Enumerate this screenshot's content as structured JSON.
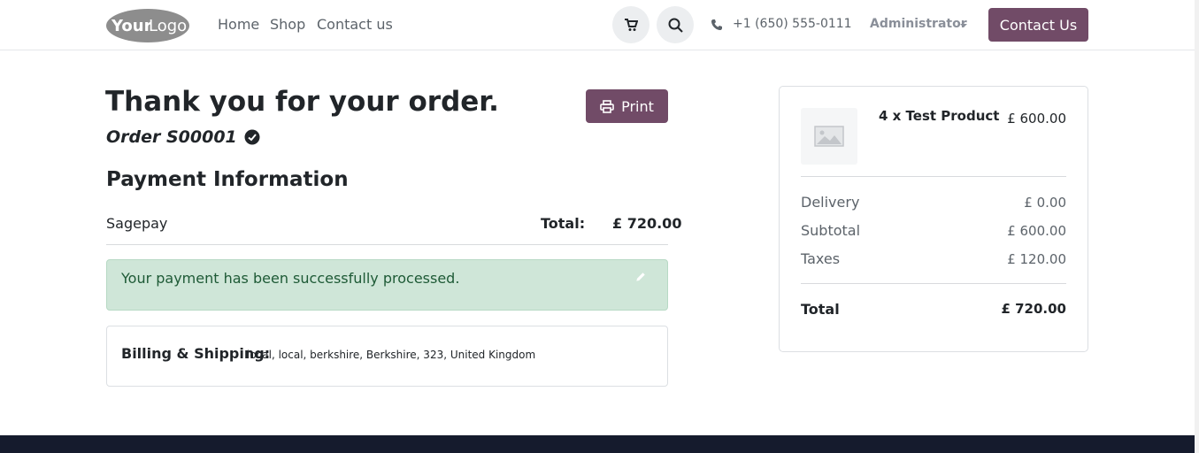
{
  "brand": {
    "logo_text": "YourLogo",
    "accent": "#714b67"
  },
  "nav": {
    "items": [
      {
        "label": "Home"
      },
      {
        "label": "Shop"
      },
      {
        "label": "Contact us"
      }
    ]
  },
  "header": {
    "cart_icon": "cart-icon",
    "search_icon": "search-icon",
    "phone": "+1 (650) 555-0111",
    "user": "Administrator",
    "contact_button": "Contact Us"
  },
  "order": {
    "title": "Thank you for your order.",
    "print_label": "Print",
    "number": "Order S00001"
  },
  "payment": {
    "section_title": "Payment Information",
    "method": "Sagepay",
    "total_label": "Total:",
    "total_value": "£ 720.00",
    "success_message": "Your payment has been successfully processed."
  },
  "billing": {
    "label": "Billing & Shipping:",
    "address": "local, local, berkshire, Berkshire, 323, United Kingdom"
  },
  "summary": {
    "product": {
      "name": "4 x Test Product",
      "price": "£ 600.00"
    },
    "rows": [
      {
        "label": "Delivery",
        "value": "£ 0.00"
      },
      {
        "label": "Subtotal",
        "value": "£ 600.00"
      },
      {
        "label": "Taxes",
        "value": "£ 120.00"
      }
    ],
    "total_label": "Total",
    "total_value": "£ 720.00"
  }
}
